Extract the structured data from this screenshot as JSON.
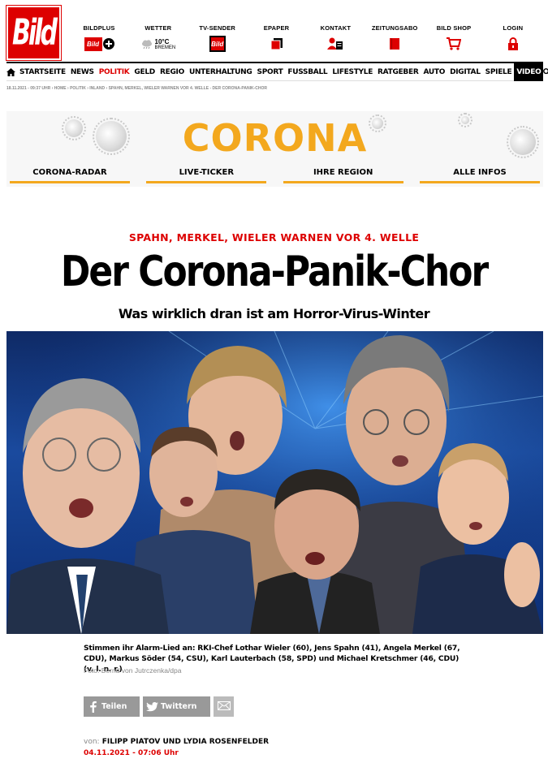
{
  "brand": {
    "logo_text": "Bild",
    "accent": "#dd0000",
    "corona_color": "#f3a81e"
  },
  "top_nav": [
    {
      "label": "BILDPLUS",
      "icon": "bildplus-icon",
      "icon_text": "Bild"
    },
    {
      "label": "WETTER",
      "icon": "weather-cloud-icon",
      "temp": "10°C",
      "city": "BREMEN"
    },
    {
      "label": "TV-SENDER",
      "icon": "bild-tv-icon",
      "icon_text": "Bild"
    },
    {
      "label": "EPAPER",
      "icon": "epaper-icon"
    },
    {
      "label": "KONTAKT",
      "icon": "contact-icon"
    },
    {
      "label": "ZEITUNGSABO",
      "icon": "newspaper-icon"
    },
    {
      "label": "BILD SHOP",
      "icon": "cart-icon"
    },
    {
      "label": "LOGIN",
      "icon": "lock-icon"
    }
  ],
  "main_nav": [
    "STARTSEITE",
    "NEWS",
    "POLITIK",
    "GELD",
    "REGIO",
    "UNTERHALTUNG",
    "SPORT",
    "FUSSBALL",
    "LIFESTYLE",
    "RATGEBER",
    "AUTO",
    "DIGITAL",
    "SPIELE",
    "VIDEO"
  ],
  "main_nav_active": "POLITIK",
  "breadcrumb": "18.11.2021 - 09:37 UHR  ›  HOME  › POLITIK  › INLAND  › SPAHN, MERKEL, WIELER WARNEN VOR 4. WELLE - DER CORONA-PANIK-CHOR",
  "corona": {
    "title": "CORONA",
    "tabs": [
      "CORONA-RADAR",
      "LIVE-TICKER",
      "IHRE REGION",
      "ALLE INFOS"
    ]
  },
  "article": {
    "kicker": "SPAHN, MERKEL, WIELER WARNEN VOR 4. WELLE",
    "headline": "Der Corona-Panik-Chor",
    "subline": "Was wirklich dran ist am Horror-Virus-Winter",
    "caption": "Stimmen ihr Alarm-Lied an: RKI-Chef Lothar Wieler (60), Jens Spahn (41), Angela Merkel (67, CDU), Markus Söder (54, CSU), Karl Lauterbach (58, SPD) und Michael Kretschmer (46, CDU) (v. l. n. r.)",
    "credit": "Foto: Bernd von Jutrczenka/dpa",
    "share": {
      "facebook": "Teilen",
      "twitter": "Twittern"
    },
    "author_prefix": "von:",
    "authors": "FILIPP PIATOV UND LYDIA ROSENFELDER",
    "date": "04.11.2021 - 07:06 Uhr"
  }
}
